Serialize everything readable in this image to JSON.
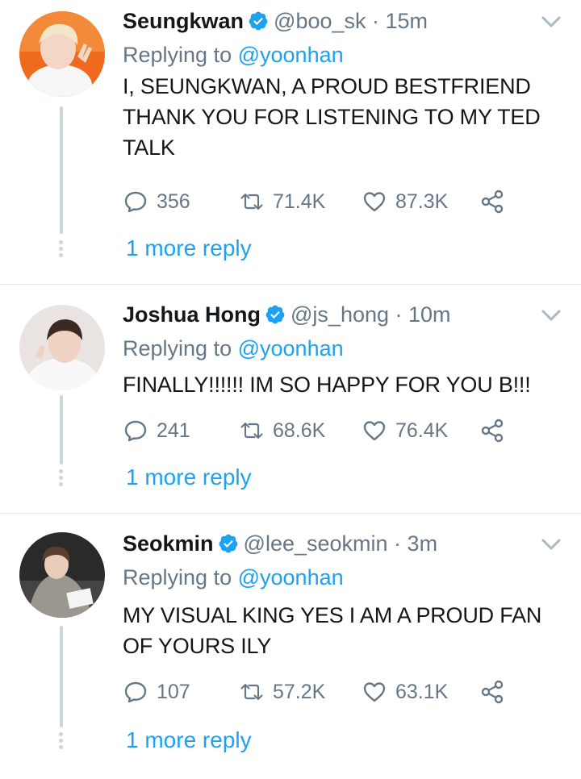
{
  "replying_prefix": "Replying to",
  "tweets": [
    {
      "name": "Seungkwan",
      "handle": "@boo_sk",
      "time": "15m",
      "reply_to": "@yoonhan",
      "text": "I, SEUNGKWAN, A PROUD BESTFRIEND THANK YOU FOR LISTENING TO MY TED TALK",
      "replies": "356",
      "retweets": "71.4K",
      "likes": "87.3K",
      "more_replies": "1 more reply"
    },
    {
      "name": "Joshua Hong",
      "handle": "@js_hong",
      "time": "10m",
      "reply_to": "@yoonhan",
      "text": "FINALLY!!!!!! IM SO HAPPY FOR YOU B!!!",
      "replies": "241",
      "retweets": "68.6K",
      "likes": "76.4K",
      "more_replies": "1 more reply"
    },
    {
      "name": "Seokmin",
      "handle": "@lee_seokmin",
      "time": "3m",
      "reply_to": "@yoonhan",
      "text": "MY VISUAL KING YES I AM A PROUD FAN OF YOURS ILY",
      "replies": "107",
      "retweets": "57.2K",
      "likes": "63.1K",
      "more_replies": "1 more reply"
    }
  ],
  "colors": {
    "link": "#1da1f2",
    "secondary": "#657786",
    "text": "#14171a",
    "divider": "#e1e8ed",
    "thread": "#ccd6dd"
  },
  "icons": {
    "verified": "verified-badge-icon",
    "caret": "chevron-down-icon",
    "reply": "reply-icon",
    "retweet": "retweet-icon",
    "like": "heart-icon",
    "share": "share-icon"
  }
}
